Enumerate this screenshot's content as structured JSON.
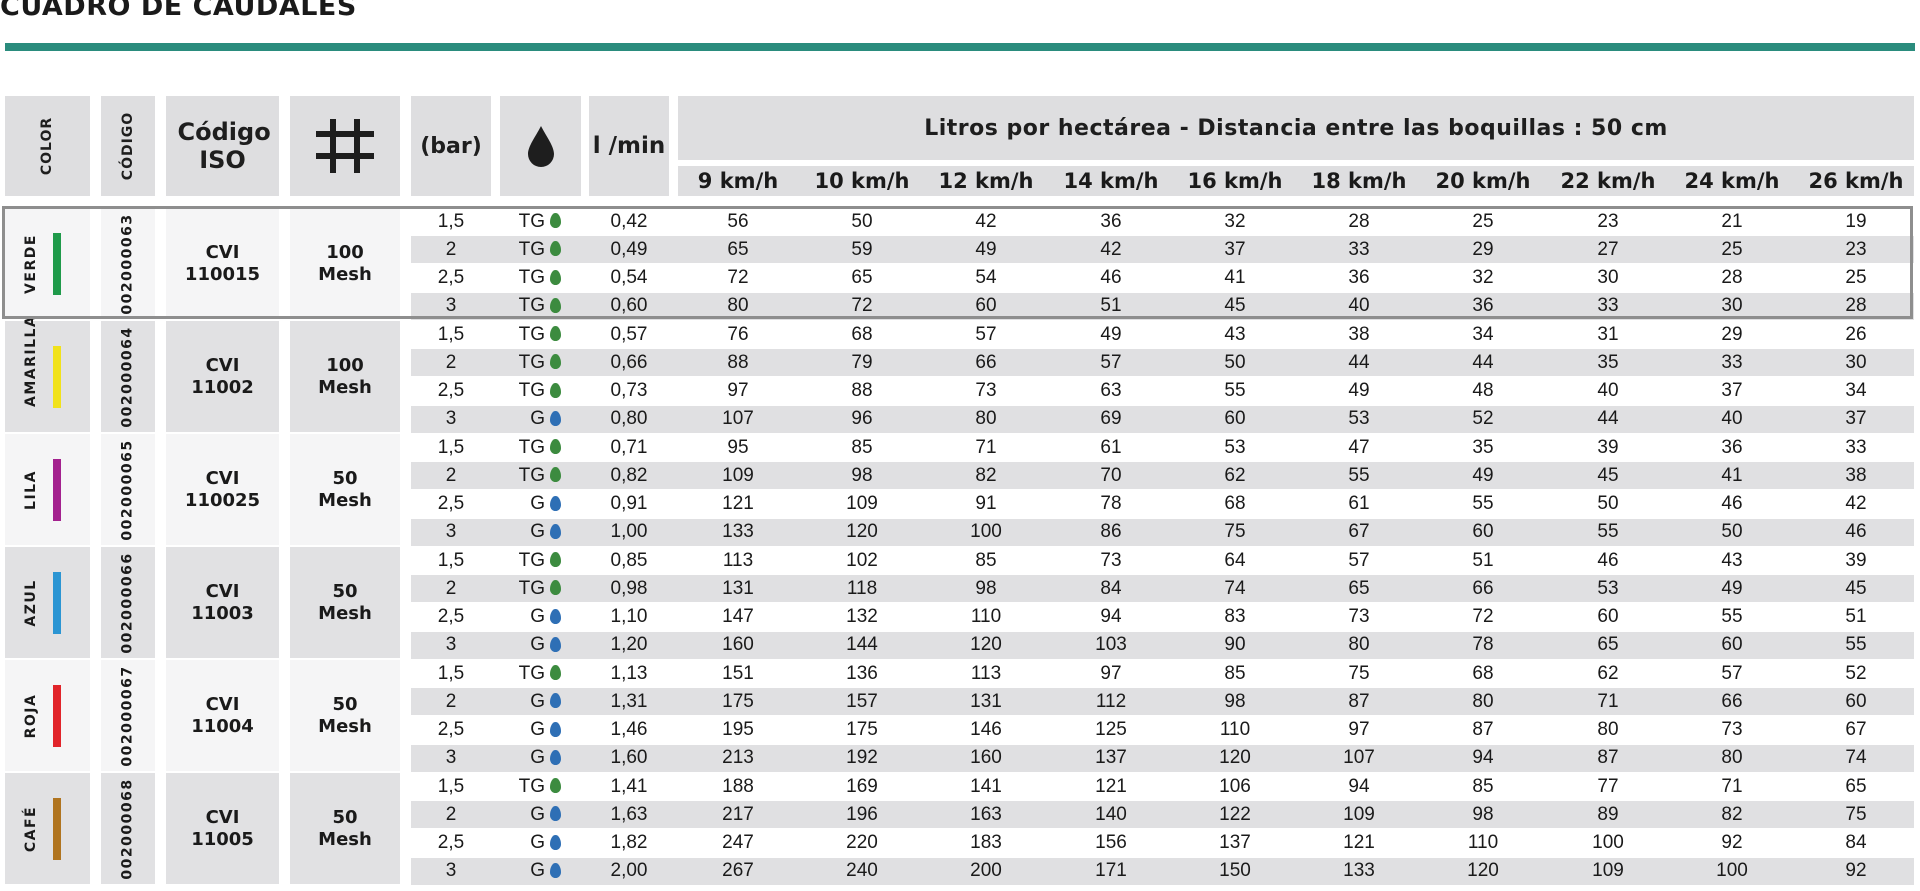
{
  "title": "CUADRO DE CAUDALES",
  "headers": {
    "color": "COLOR",
    "codigo": "CÓDIGO",
    "iso": "Código ISO",
    "mesh_icon": "grid-icon",
    "bar": "(bar)",
    "drop_icon": "droplet-icon",
    "lmin": "l /min",
    "group": "Litros por hectárea - Distancia entre las boquillas : 50 cm",
    "speeds": [
      "9 km/h",
      "10 km/h",
      "12 km/h",
      "14 km/h",
      "16 km/h",
      "18 km/h",
      "20 km/h",
      "22 km/h",
      "24 km/h",
      "26 km/h"
    ]
  },
  "colors": {
    "accent_rule": "#2a8c7d",
    "header_bg": "#dedee0",
    "drop_green": "#3c8b3f",
    "drop_blue": "#2e6fb5"
  },
  "groups": [
    {
      "color_name": "VERDE",
      "swatch": "#1f9a4a",
      "code": "002000063",
      "iso_line1": "CVI",
      "iso_line2": "110015",
      "mesh_line1": "100",
      "mesh_line2": "Mesh",
      "rows": [
        {
          "bar": "1,5",
          "drop": "TG",
          "drop_color": "green",
          "lmin": "0,42",
          "values": [
            "56",
            "50",
            "42",
            "36",
            "32",
            "28",
            "25",
            "23",
            "21",
            "19"
          ]
        },
        {
          "bar": "2",
          "drop": "TG",
          "drop_color": "green",
          "lmin": "0,49",
          "values": [
            "65",
            "59",
            "49",
            "42",
            "37",
            "33",
            "29",
            "27",
            "25",
            "23"
          ]
        },
        {
          "bar": "2,5",
          "drop": "TG",
          "drop_color": "green",
          "lmin": "0,54",
          "values": [
            "72",
            "65",
            "54",
            "46",
            "41",
            "36",
            "32",
            "30",
            "28",
            "25"
          ]
        },
        {
          "bar": "3",
          "drop": "TG",
          "drop_color": "green",
          "lmin": "0,60",
          "values": [
            "80",
            "72",
            "60",
            "51",
            "45",
            "40",
            "36",
            "33",
            "30",
            "28"
          ]
        }
      ]
    },
    {
      "color_name": "AMARILLA",
      "swatch": "#f1e21b",
      "code": "002000064",
      "iso_line1": "CVI",
      "iso_line2": "11002",
      "mesh_line1": "100",
      "mesh_line2": "Mesh",
      "rows": [
        {
          "bar": "1,5",
          "drop": "TG",
          "drop_color": "green",
          "lmin": "0,57",
          "values": [
            "76",
            "68",
            "57",
            "49",
            "43",
            "38",
            "34",
            "31",
            "29",
            "26"
          ]
        },
        {
          "bar": "2",
          "drop": "TG",
          "drop_color": "green",
          "lmin": "0,66",
          "values": [
            "88",
            "79",
            "66",
            "57",
            "50",
            "44",
            "44",
            "35",
            "33",
            "30"
          ]
        },
        {
          "bar": "2,5",
          "drop": "TG",
          "drop_color": "green",
          "lmin": "0,73",
          "values": [
            "97",
            "88",
            "73",
            "63",
            "55",
            "49",
            "48",
            "40",
            "37",
            "34"
          ]
        },
        {
          "bar": "3",
          "drop": "G",
          "drop_color": "blue",
          "lmin": "0,80",
          "values": [
            "107",
            "96",
            "80",
            "69",
            "60",
            "53",
            "52",
            "44",
            "40",
            "37"
          ]
        }
      ]
    },
    {
      "color_name": "LILA",
      "swatch": "#a3218e",
      "code": "002000065",
      "iso_line1": "CVI",
      "iso_line2": "110025",
      "mesh_line1": "50",
      "mesh_line2": "Mesh",
      "rows": [
        {
          "bar": "1,5",
          "drop": "TG",
          "drop_color": "green",
          "lmin": "0,71",
          "values": [
            "95",
            "85",
            "71",
            "61",
            "53",
            "47",
            "35",
            "39",
            "36",
            "33"
          ]
        },
        {
          "bar": "2",
          "drop": "TG",
          "drop_color": "green",
          "lmin": "0,82",
          "values": [
            "109",
            "98",
            "82",
            "70",
            "62",
            "55",
            "49",
            "45",
            "41",
            "38"
          ]
        },
        {
          "bar": "2,5",
          "drop": "G",
          "drop_color": "blue",
          "lmin": "0,91",
          "values": [
            "121",
            "109",
            "91",
            "78",
            "68",
            "61",
            "55",
            "50",
            "46",
            "42"
          ]
        },
        {
          "bar": "3",
          "drop": "G",
          "drop_color": "blue",
          "lmin": "1,00",
          "values": [
            "133",
            "120",
            "100",
            "86",
            "75",
            "67",
            "60",
            "55",
            "50",
            "46"
          ]
        }
      ]
    },
    {
      "color_name": "AZUL",
      "swatch": "#2b95d3",
      "code": "002000066",
      "iso_line1": "CVI",
      "iso_line2": "11003",
      "mesh_line1": "50",
      "mesh_line2": "Mesh",
      "rows": [
        {
          "bar": "1,5",
          "drop": "TG",
          "drop_color": "green",
          "lmin": "0,85",
          "values": [
            "113",
            "102",
            "85",
            "73",
            "64",
            "57",
            "51",
            "46",
            "43",
            "39"
          ]
        },
        {
          "bar": "2",
          "drop": "TG",
          "drop_color": "green",
          "lmin": "0,98",
          "values": [
            "131",
            "118",
            "98",
            "84",
            "74",
            "65",
            "66",
            "53",
            "49",
            "45"
          ]
        },
        {
          "bar": "2,5",
          "drop": "G",
          "drop_color": "blue",
          "lmin": "1,10",
          "values": [
            "147",
            "132",
            "110",
            "94",
            "83",
            "73",
            "72",
            "60",
            "55",
            "51"
          ]
        },
        {
          "bar": "3",
          "drop": "G",
          "drop_color": "blue",
          "lmin": "1,20",
          "values": [
            "160",
            "144",
            "120",
            "103",
            "90",
            "80",
            "78",
            "65",
            "60",
            "55"
          ]
        }
      ]
    },
    {
      "color_name": "ROJA",
      "swatch": "#e1242a",
      "code": "002000067",
      "iso_line1": "CVI",
      "iso_line2": "11004",
      "mesh_line1": "50",
      "mesh_line2": "Mesh",
      "rows": [
        {
          "bar": "1,5",
          "drop": "TG",
          "drop_color": "green",
          "lmin": "1,13",
          "values": [
            "151",
            "136",
            "113",
            "97",
            "85",
            "75",
            "68",
            "62",
            "57",
            "52"
          ]
        },
        {
          "bar": "2",
          "drop": "G",
          "drop_color": "blue",
          "lmin": "1,31",
          "values": [
            "175",
            "157",
            "131",
            "112",
            "98",
            "87",
            "80",
            "71",
            "66",
            "60"
          ]
        },
        {
          "bar": "2,5",
          "drop": "G",
          "drop_color": "blue",
          "lmin": "1,46",
          "values": [
            "195",
            "175",
            "146",
            "125",
            "110",
            "97",
            "87",
            "80",
            "73",
            "67"
          ]
        },
        {
          "bar": "3",
          "drop": "G",
          "drop_color": "blue",
          "lmin": "1,60",
          "values": [
            "213",
            "192",
            "160",
            "137",
            "120",
            "107",
            "94",
            "87",
            "80",
            "74"
          ]
        }
      ]
    },
    {
      "color_name": "CAFÉ",
      "swatch": "#b0741f",
      "code": "002000068",
      "iso_line1": "CVI",
      "iso_line2": "11005",
      "mesh_line1": "50",
      "mesh_line2": "Mesh",
      "rows": [
        {
          "bar": "1,5",
          "drop": "TG",
          "drop_color": "green",
          "lmin": "1,41",
          "values": [
            "188",
            "169",
            "141",
            "121",
            "106",
            "94",
            "85",
            "77",
            "71",
            "65"
          ]
        },
        {
          "bar": "2",
          "drop": "G",
          "drop_color": "blue",
          "lmin": "1,63",
          "values": [
            "217",
            "196",
            "163",
            "140",
            "122",
            "109",
            "98",
            "89",
            "82",
            "75"
          ]
        },
        {
          "bar": "2,5",
          "drop": "G",
          "drop_color": "blue",
          "lmin": "1,82",
          "values": [
            "247",
            "220",
            "183",
            "156",
            "137",
            "121",
            "110",
            "100",
            "92",
            "84"
          ]
        },
        {
          "bar": "3",
          "drop": "G",
          "drop_color": "blue",
          "lmin": "2,00",
          "values": [
            "267",
            "240",
            "200",
            "171",
            "150",
            "133",
            "120",
            "109",
            "100",
            "92"
          ]
        }
      ]
    }
  ]
}
